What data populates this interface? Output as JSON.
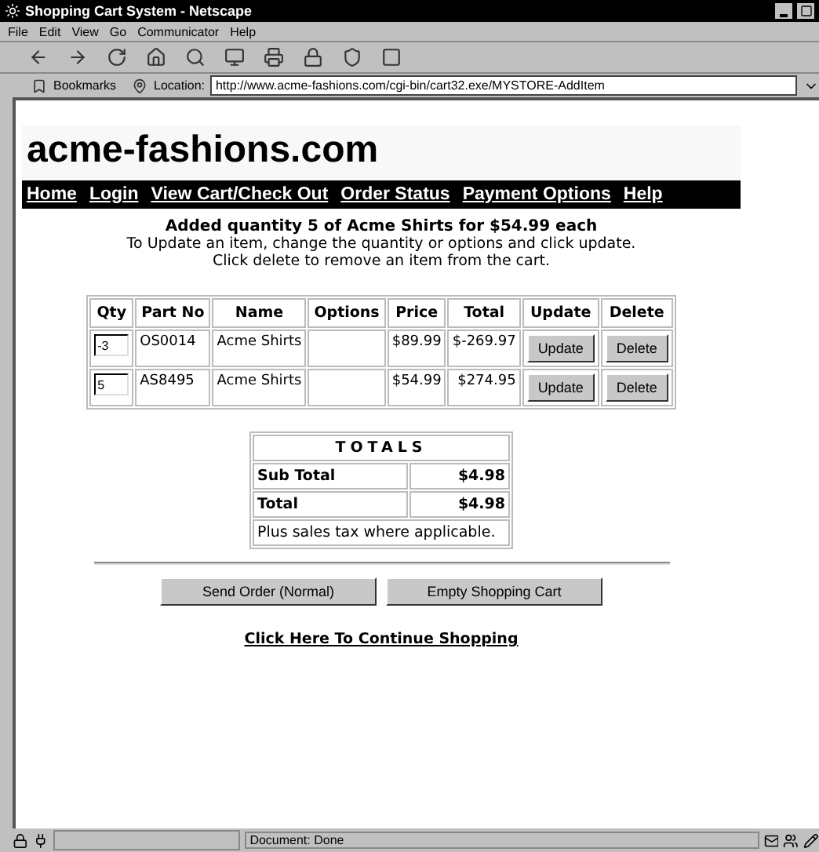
{
  "window": {
    "title": "Shopping Cart System - Netscape"
  },
  "menu": [
    "File",
    "Edit",
    "View",
    "Go",
    "Communicator",
    "Help"
  ],
  "location_bar": {
    "bookmarks": "Bookmarks",
    "label": "Location:",
    "url": "http://www.acme-fashions.com/cgi-bin/cart32.exe/MYSTORE-AddItem"
  },
  "site": {
    "logo": "acme-fashions.com",
    "nav": [
      "Home",
      "Login",
      "View Cart/Check Out",
      "Order Status",
      "Payment Options",
      "Help"
    ]
  },
  "message": {
    "heading": "Added quantity 5 of Acme Shirts for $54.99 each",
    "lines": [
      "To Update an item, change the quantity or options and click update.",
      "Click delete to remove an item from the cart."
    ]
  },
  "cart": {
    "columns": [
      "Qty",
      "Part No",
      "Name",
      "Options",
      "Price",
      "Total",
      "Update",
      "Delete"
    ],
    "rows": [
      {
        "qty": "-3",
        "part_no": "OS0014",
        "name": "Acme Shirts",
        "price": "$89.99",
        "total": "$-269.97",
        "update": "Update",
        "delete": "Delete"
      },
      {
        "qty": "5",
        "part_no": "AS8495",
        "name": "Acme Shirts",
        "price": "$54.99",
        "total": "$274.95",
        "update": "Update",
        "delete": "Delete"
      }
    ]
  },
  "totals": {
    "title": "TOTALS",
    "rows": [
      {
        "label": "Sub Total",
        "value": "$4.98"
      },
      {
        "label": "Total",
        "value": "$4.98"
      }
    ],
    "note": "Plus sales tax where applicable."
  },
  "buttons": [
    "Send Order (Normal)",
    "Empty Shopping Cart"
  ],
  "continue_link": "Click Here To Continue Shopping",
  "status_bar": {
    "text": "Document: Done"
  }
}
